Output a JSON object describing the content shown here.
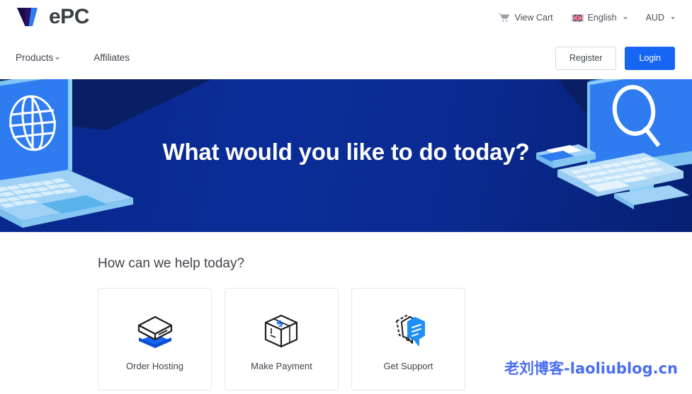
{
  "brand": {
    "logo_mark": "W",
    "logo_text": "ePC",
    "logo_color_dark": "#1a0a4a",
    "logo_color_blue": "#2f7cf0",
    "logo_text_color": "#3a3f45"
  },
  "utility_bar": {
    "items": [
      {
        "name": "view-cart",
        "icon": "cart-icon",
        "label": "View Cart",
        "caret": false
      },
      {
        "name": "language-selector",
        "icon": "uk-flag-icon",
        "label": "English",
        "caret": true
      },
      {
        "name": "currency-selector",
        "icon": null,
        "label": "AUD",
        "caret": true
      }
    ]
  },
  "main_nav": {
    "links": [
      {
        "label": "Products",
        "caret": true
      },
      {
        "label": "Affiliates",
        "caret": false
      }
    ],
    "register_label": "Register",
    "login_label": "Login",
    "login_color": "#1765f3"
  },
  "hero": {
    "title": "What would you like to do today?",
    "background_color": "#0a2b94",
    "left_illustration": "isometric-laptop-globe",
    "right_illustration": "isometric-desktop-magnifier"
  },
  "help": {
    "title": "How can we help today?",
    "cards": [
      {
        "label": "Order Hosting",
        "icon": "server-box-icon"
      },
      {
        "label": "Make Payment",
        "icon": "package-dollar-icon"
      },
      {
        "label": "Get Support",
        "icon": "chat-bubbles-icon"
      }
    ]
  },
  "watermark": {
    "text": "老刘博客-laoliublog.cn",
    "color": "#4a6ef0"
  }
}
